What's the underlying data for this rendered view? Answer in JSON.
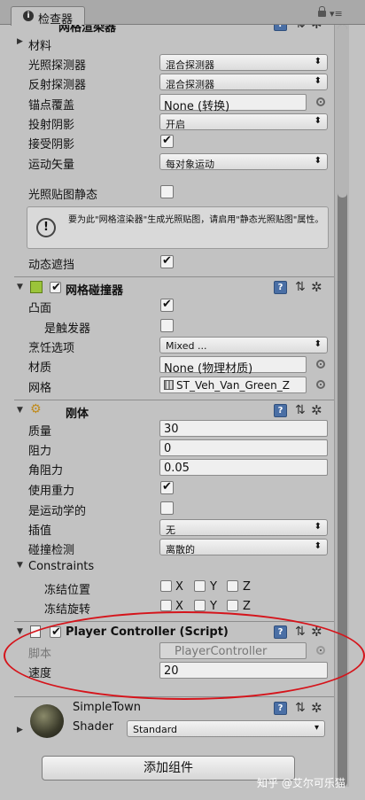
{
  "tab": {
    "label": "检查器",
    "icon": "info-icon"
  },
  "top_header_partial": "网格渲染器",
  "renderer": {
    "materials_label": "材料",
    "light_probes": {
      "label": "光照探测器",
      "value": "混合探测器"
    },
    "reflection_probes": {
      "label": "反射探测器",
      "value": "混合探测器"
    },
    "anchor_override": {
      "label": "锚点覆盖",
      "value": "None (转换)"
    },
    "cast_shadows": {
      "label": "投射阴影",
      "value": "开启"
    },
    "receive_shadows": {
      "label": "接受阴影",
      "checked": true
    },
    "motion_vectors": {
      "label": "运动矢量",
      "value": "每对象运动"
    },
    "lightmap_static": {
      "label": "光照贴图静态",
      "checked": false
    },
    "info_message": "要为此\"网格渲染器\"生成光照贴图，请启用\"静态光照贴图\"属性。",
    "dynamic_occluded": {
      "label": "动态遮挡",
      "checked": true
    }
  },
  "mesh_collider": {
    "title": "网格碰撞器",
    "enabled": true,
    "convex": {
      "label": "凸面",
      "checked": true
    },
    "is_trigger": {
      "label": "是触发器",
      "checked": false
    },
    "cooking_options": {
      "label": "烹饪选项",
      "value": "Mixed ..."
    },
    "material": {
      "label": "材质",
      "value": "None (物理材质)"
    },
    "mesh": {
      "label": "网格",
      "value": "ST_Veh_Van_Green_Z"
    }
  },
  "rigidbody": {
    "title": "刚体",
    "mass": {
      "label": "质量",
      "value": "30"
    },
    "drag": {
      "label": "阻力",
      "value": "0"
    },
    "angular_drag": {
      "label": "角阻力",
      "value": "0.05"
    },
    "use_gravity": {
      "label": "使用重力",
      "checked": true
    },
    "is_kinematic": {
      "label": "是运动学的",
      "checked": false
    },
    "interpolate": {
      "label": "插值",
      "value": "无"
    },
    "collision_detection": {
      "label": "碰撞检测",
      "value": "离散的"
    },
    "constraints_label": "Constraints",
    "freeze_position": {
      "label": "冻结位置",
      "axes": [
        "X",
        "Y",
        "Z"
      ]
    },
    "freeze_rotation": {
      "label": "冻结旋转",
      "axes": [
        "X",
        "Y",
        "Z"
      ]
    }
  },
  "player_controller": {
    "title": "Player Controller (Script)",
    "enabled": true,
    "script": {
      "label": "脚本",
      "value": "PlayerController"
    },
    "speed": {
      "label": "速度",
      "value": "20"
    }
  },
  "material_preview": {
    "name": "SimpleTown",
    "shader_label": "Shader",
    "shader_value": "Standard"
  },
  "add_component": "添加组件",
  "watermark": "知乎 @艾尔可乐猫",
  "colors": {
    "highlight": "#d5141b",
    "help_icon": "#4a6fa5",
    "panel_bg": "#c2c2c2"
  }
}
